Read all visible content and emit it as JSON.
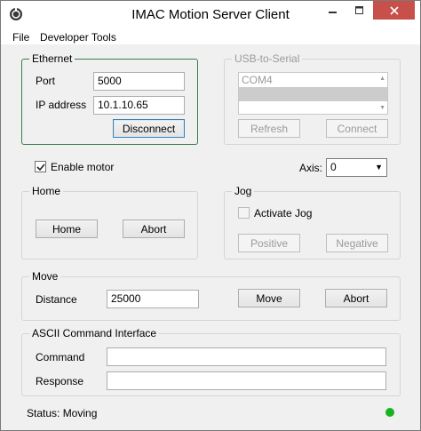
{
  "window": {
    "title": "IMAC Motion Server Client"
  },
  "menu": {
    "items": [
      "File",
      "Developer Tools"
    ]
  },
  "ethernet": {
    "legend": "Ethernet",
    "port_label": "Port",
    "port_value": "5000",
    "ip_label": "IP address",
    "ip_value": "10.1.10.65",
    "disconnect_label": "Disconnect"
  },
  "usb": {
    "legend": "USB-to-Serial",
    "ports": [
      "COM4",
      ""
    ],
    "refresh_label": "Refresh",
    "connect_label": "Connect"
  },
  "motor": {
    "enable_label": "Enable motor",
    "enable_checked": true,
    "axis_label": "Axis:",
    "axis_value": "0"
  },
  "home": {
    "legend": "Home",
    "home_label": "Home",
    "abort_label": "Abort"
  },
  "jog": {
    "legend": "Jog",
    "activate_label": "Activate Jog",
    "activate_checked": false,
    "positive_label": "Positive",
    "negative_label": "Negative"
  },
  "move": {
    "legend": "Move",
    "distance_label": "Distance",
    "distance_value": "25000",
    "move_label": "Move",
    "abort_label": "Abort"
  },
  "ascii": {
    "legend": "ASCII Command Interface",
    "command_label": "Command",
    "command_value": "",
    "response_label": "Response",
    "response_value": ""
  },
  "status": {
    "text": "Status: Moving",
    "indicator_color": "#17b41f"
  },
  "colors": {
    "close_button": "#c7504a",
    "ethernet_border": "#3f7a48"
  }
}
